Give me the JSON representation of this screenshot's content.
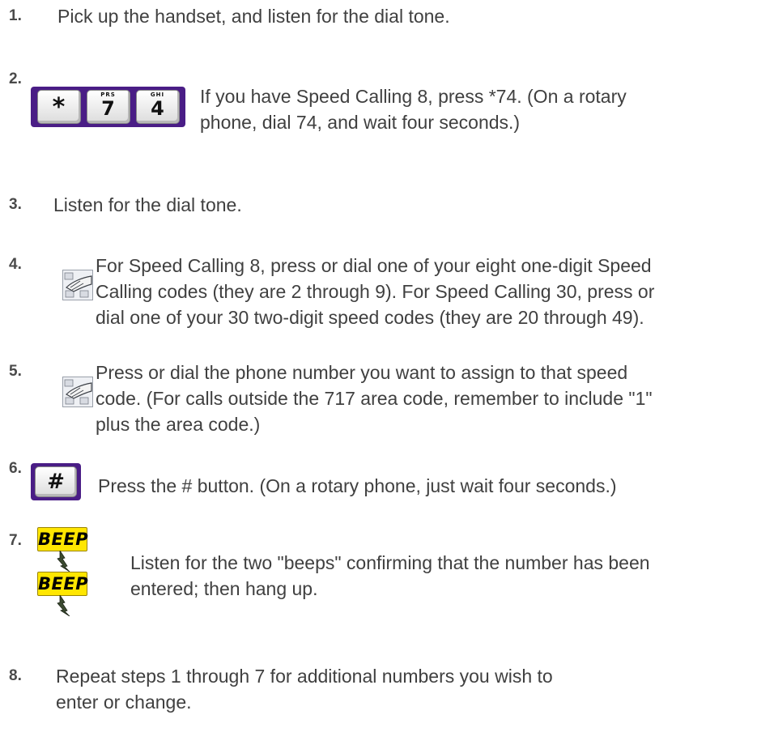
{
  "steps": [
    {
      "number": "1.",
      "lines": [
        "Pick up the handset, and listen for the dial tone."
      ]
    },
    {
      "number": "2.",
      "lines": [
        "If you have Speed Calling 8, press *74. (On a rotary",
        "phone, dial 74, and wait four seconds.)"
      ],
      "keys": [
        {
          "digit": "*",
          "letters": ""
        },
        {
          "digit": "7",
          "letters": "PRS"
        },
        {
          "digit": "4",
          "letters": "GHI"
        }
      ]
    },
    {
      "number": "3.",
      "lines": [
        "Listen for the dial tone."
      ]
    },
    {
      "number": "4.",
      "lines": [
        "For Speed Calling 8, press or dial one of your eight one-digit Speed",
        "Calling codes (they are 2 through 9). For Speed Calling 30, press or",
        "dial one of your 30 two-digit speed codes (they are 20 through 49)."
      ]
    },
    {
      "number": "5.",
      "lines": [
        "Press or dial the phone number you want to assign to that speed",
        "code. (For calls outside the 717 area code, remember to include \"1\"",
        "plus the area code.)"
      ]
    },
    {
      "number": "6.",
      "lines": [
        "Press the # button. (On a rotary phone, just wait four seconds.)"
      ],
      "keys": [
        {
          "digit": "#",
          "letters": ""
        }
      ]
    },
    {
      "number": "7.",
      "lines": [
        "Listen for the two \"beeps\" confirming that the number has been",
        "entered; then hang up."
      ],
      "beeps": [
        "BEEP",
        "BEEP"
      ]
    },
    {
      "number": "8.",
      "lines": [
        "Repeat steps 1 through 7 for additional numbers you wish to",
        "enter or change."
      ]
    }
  ],
  "colors": {
    "text": "#404040",
    "keypad_frame": "#4a1d86",
    "beep_fill": "#ffe600"
  },
  "icons": {
    "keypad_hand": "keypad-hand-icon",
    "lightning": "lightning-bolt-icon"
  }
}
